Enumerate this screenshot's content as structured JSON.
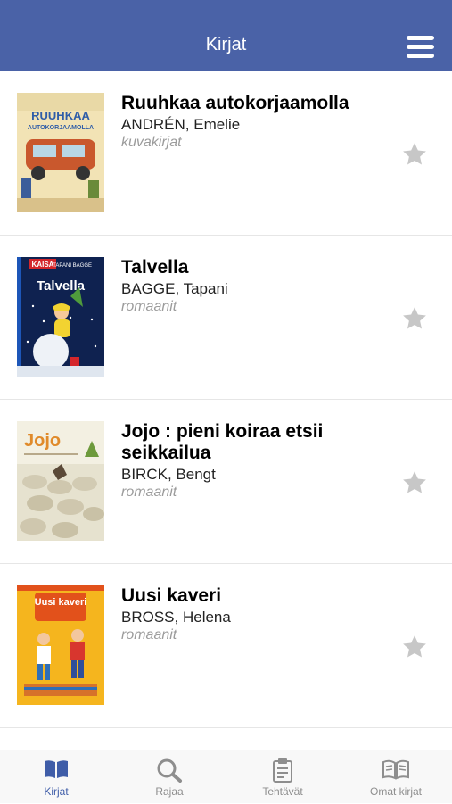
{
  "header": {
    "title": "Kirjat",
    "menu_icon": "hamburger-menu-icon",
    "background": "#4a62a7"
  },
  "books": [
    {
      "title": "Ruuhkaa autokorjaamolla",
      "author": "ANDRÉN, Emelie",
      "genre": "kuvakirjat",
      "cover_text": "RUUHKAA",
      "cover_subtext": "AUTOKORJAAMOLLA"
    },
    {
      "title": "Talvella",
      "author": "BAGGE, Tapani",
      "genre": "romaanit",
      "cover_text": "Talvella",
      "cover_series": "KAISA",
      "cover_author": "TAPANI BAGGE"
    },
    {
      "title": "Jojo : pieni koiraa etsii seikkailua",
      "author": "BIRCK, Bengt",
      "genre": "romaanit",
      "cover_text": "Jojo"
    },
    {
      "title": "Uusi kaveri",
      "author": "BROSS, Helena",
      "genre": "romaanit",
      "cover_text": "Uusi kaveri"
    }
  ],
  "tabs": [
    {
      "label": "Kirjat",
      "icon": "book-icon",
      "active": true
    },
    {
      "label": "Rajaa",
      "icon": "search-icon",
      "active": false
    },
    {
      "label": "Tehtävät",
      "icon": "clipboard-icon",
      "active": false
    },
    {
      "label": "Omat kirjat",
      "icon": "open-book-icon",
      "active": false
    }
  ],
  "colors": {
    "accent": "#4a62a7",
    "tab_active": "#3f5da8",
    "star": "#c7c7c7"
  }
}
